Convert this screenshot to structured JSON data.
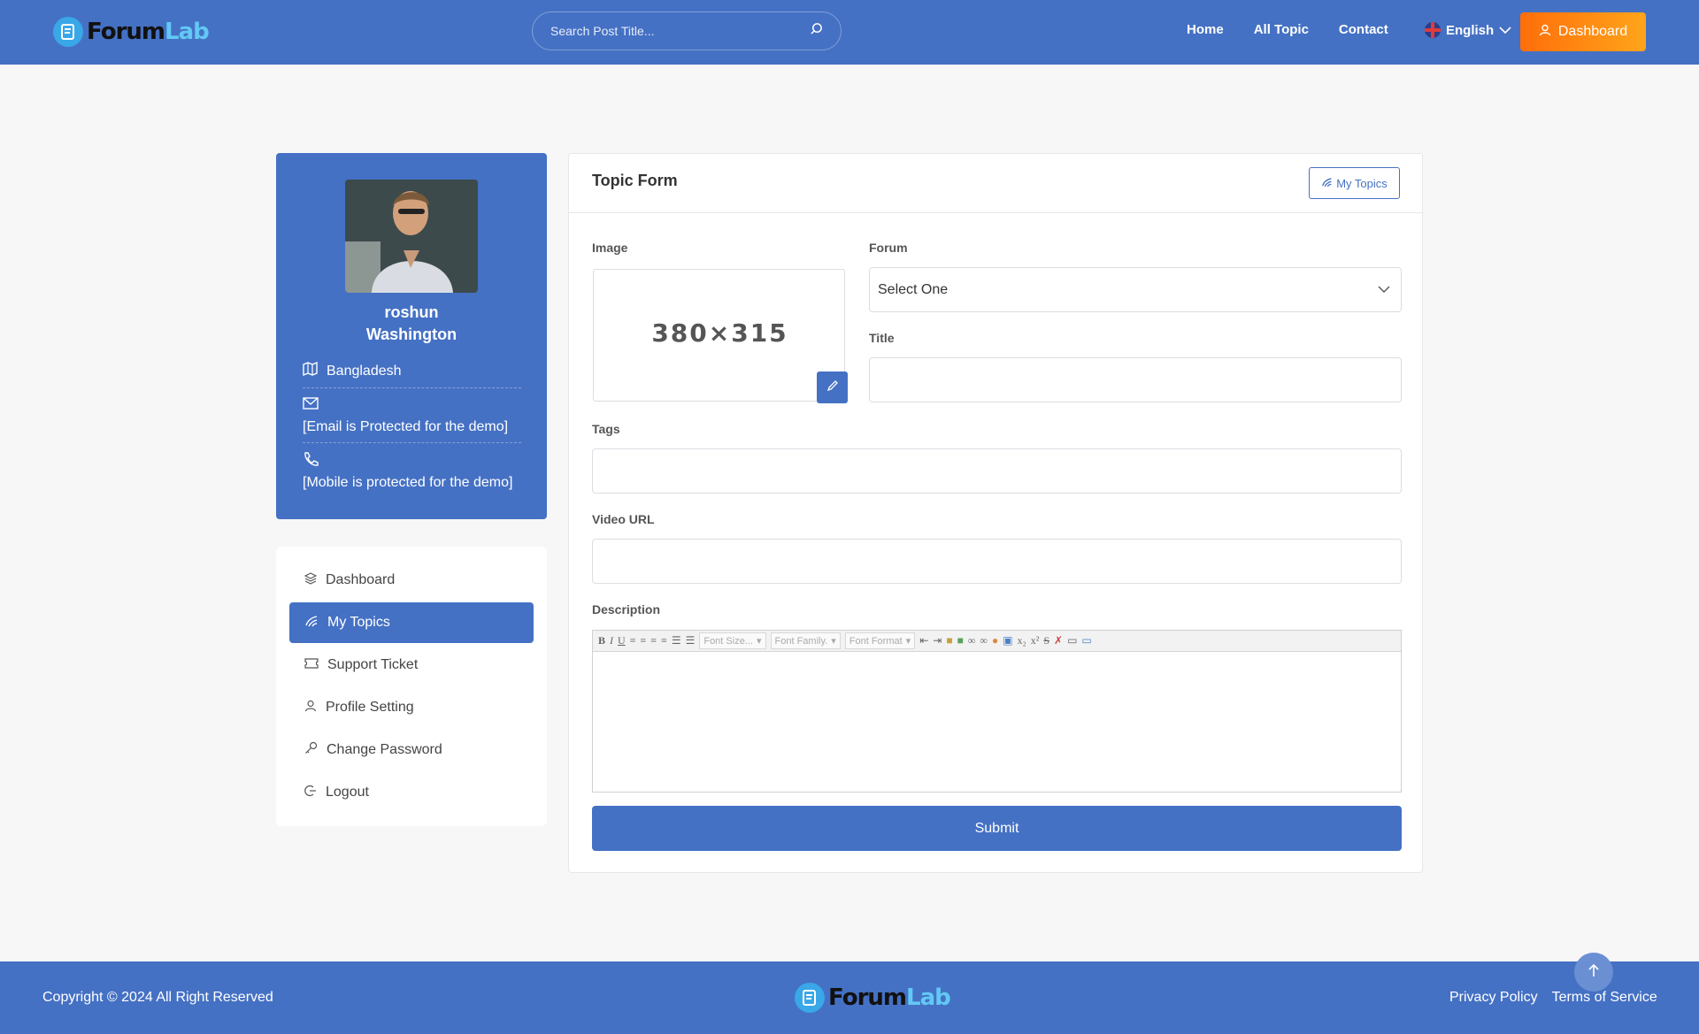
{
  "header": {
    "logo": {
      "part1": "Forum",
      "part2": "Lab"
    },
    "search": {
      "placeholder": "Search Post Title...",
      "icon": "search-icon"
    },
    "nav": [
      {
        "label": "Home"
      },
      {
        "label": "All Topic"
      },
      {
        "label": "Contact"
      }
    ],
    "language": {
      "label": "English",
      "icon": "uk-flag-icon"
    },
    "dashboard_button": {
      "label": "Dashboard",
      "icon": "user-icon"
    }
  },
  "profile": {
    "first_name": "roshun",
    "last_name": "Washington",
    "location": "Bangladesh",
    "email": "[Email is Protected for the demo]",
    "mobile": "[Mobile is protected for the demo]"
  },
  "menu": {
    "items": [
      {
        "label": "Dashboard",
        "icon": "layers-icon",
        "active": false
      },
      {
        "label": "My Topics",
        "icon": "topics-icon",
        "active": true
      },
      {
        "label": "Support Ticket",
        "icon": "ticket-icon",
        "active": false
      },
      {
        "label": "Profile Setting",
        "icon": "user-icon",
        "active": false
      },
      {
        "label": "Change Password",
        "icon": "key-icon",
        "active": false
      },
      {
        "label": "Logout",
        "icon": "logout-icon",
        "active": false
      }
    ]
  },
  "form": {
    "title": "Topic Form",
    "my_topics_button": "My Topics",
    "image_label": "Image",
    "image_placeholder": "380×315",
    "forum_label": "Forum",
    "forum_value": "Select One",
    "title_label": "Title",
    "title_value": "",
    "tags_label": "Tags",
    "tags_value": "",
    "video_label": "Video URL",
    "video_value": "",
    "description_label": "Description",
    "editor_font_size": "Font Size...",
    "editor_font_family": "Font Family.",
    "editor_font_format": "Font Format",
    "submit": "Submit"
  },
  "footer": {
    "copyright": "Copyright © 2024 All Right Reserved",
    "links": [
      {
        "label": "Privacy Policy"
      },
      {
        "label": "Terms of Service"
      }
    ]
  },
  "colors": {
    "primary": "#4571c4",
    "accent_orange": "#ff8a12",
    "logo_light": "#62c8f5"
  }
}
